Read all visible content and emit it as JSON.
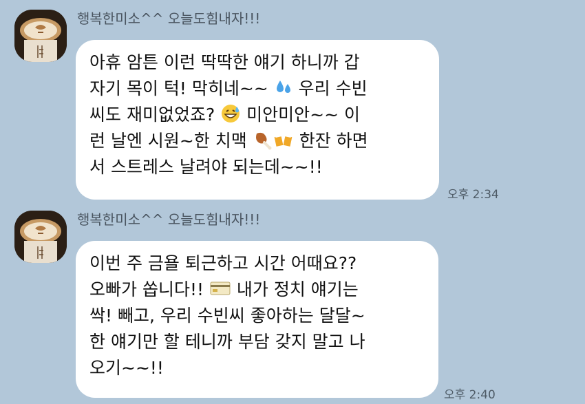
{
  "messages": [
    {
      "sender": "행복한미소^^ 오늘도힘내자!!!",
      "lines": [
        "아휴 암튼 이런 딱딱한 얘기 하니까 갑",
        "자기 목이 턱! 막히네~~ ",
        "씨도 재미없었죠? ",
        "런 날엔 시원~한 치맥 ",
        "서 스트레스 날려야 되는데~~!!"
      ],
      "line_tails": [
        "",
        "  우리 수빈",
        "  미안미안~~ 이",
        "  한잔 하면",
        ""
      ],
      "time": "오후 2:34"
    },
    {
      "sender": "행복한미소^^ 오늘도힘내자!!!",
      "lines": [
        "이번 주 금욜 퇴근하고 시간 어때요??",
        "오빠가 쏩니다!! ",
        "싹! 빼고, 우리 수빈씨 좋아하는 달달~",
        "한 얘기만 할 테니까 부담 갖지 말고 나",
        "오기~~!!"
      ],
      "line_tails": [
        "",
        "  내가 정치 얘기는",
        "",
        "",
        ""
      ],
      "time": "오후 2:40"
    }
  ],
  "emoji_icons": [
    "sweat-droplets-icon",
    "grinning-sweat-face-icon",
    "chicken-leg-icon",
    "beer-mugs-icon",
    "credit-card-icon"
  ]
}
